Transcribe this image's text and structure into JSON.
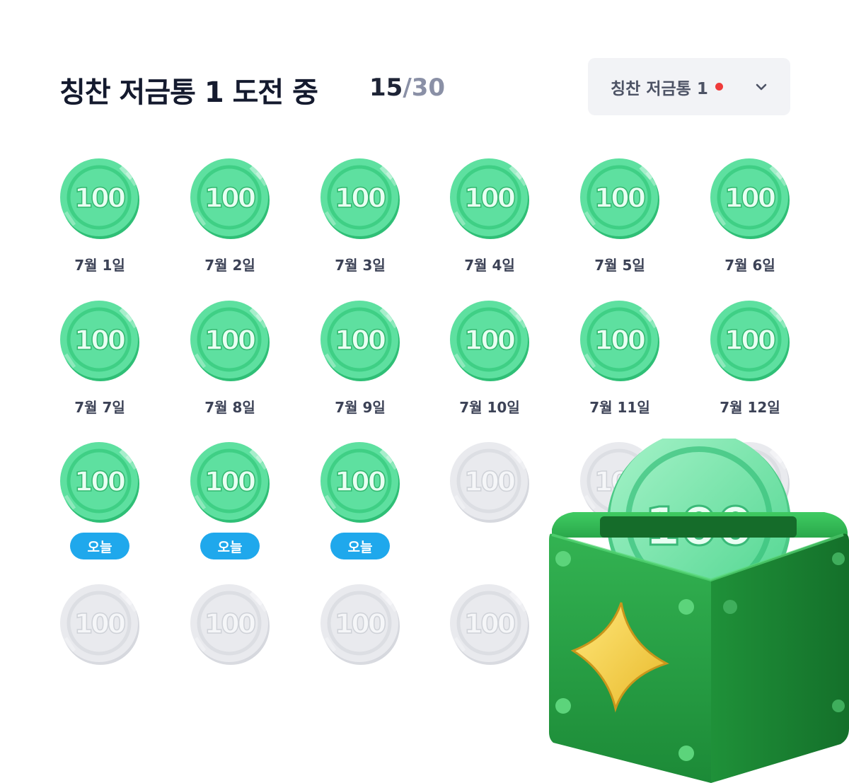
{
  "header": {
    "title": "칭찬 저금통 1 도전 중",
    "progress_current": "15",
    "progress_separator": "/",
    "progress_total": "30"
  },
  "dropdown": {
    "selected": "칭찬 저금통 1",
    "has_notification": true,
    "icon": "chevron-down-icon"
  },
  "coin_label": "100",
  "today_badge": "오늘",
  "coins": [
    {
      "label": "7월 1일",
      "state": "collected"
    },
    {
      "label": "7월 2일",
      "state": "collected"
    },
    {
      "label": "7월 3일",
      "state": "collected"
    },
    {
      "label": "7월 4일",
      "state": "collected"
    },
    {
      "label": "7월 5일",
      "state": "collected"
    },
    {
      "label": "7월 6일",
      "state": "collected"
    },
    {
      "label": "7월 7일",
      "state": "collected"
    },
    {
      "label": "7월 8일",
      "state": "collected"
    },
    {
      "label": "7월 9일",
      "state": "collected"
    },
    {
      "label": "7월 10일",
      "state": "collected"
    },
    {
      "label": "7월 11일",
      "state": "collected"
    },
    {
      "label": "7월 12일",
      "state": "collected"
    },
    {
      "label": "오늘",
      "state": "today"
    },
    {
      "label": "오늘",
      "state": "today"
    },
    {
      "label": "오늘",
      "state": "today"
    },
    {
      "label": "",
      "state": "empty"
    },
    {
      "label": "",
      "state": "empty"
    },
    {
      "label": "",
      "state": "empty"
    },
    {
      "label": "",
      "state": "empty"
    },
    {
      "label": "",
      "state": "empty"
    },
    {
      "label": "",
      "state": "empty"
    },
    {
      "label": "",
      "state": "empty"
    }
  ],
  "colors": {
    "coin_green": "#5ee0a0",
    "coin_green_dark": "#2fbf76",
    "coin_gray": "#e9eaee",
    "today_badge": "#1fa8ec",
    "notification_dot": "#ef3b3b",
    "box_green": "#27a243",
    "star_yellow": "#f7d446"
  },
  "piggy_box": {
    "coin_label": "100",
    "icon": "sparkle-star-icon"
  }
}
